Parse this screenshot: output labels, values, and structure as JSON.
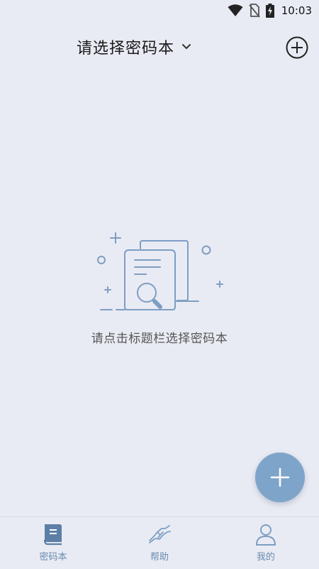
{
  "status_bar": {
    "time": "10:03",
    "icons": [
      "wifi-icon",
      "no-sim-icon",
      "battery-charging-icon"
    ]
  },
  "header": {
    "title": "请选择密码本",
    "title_icon": "chevron-down-icon",
    "action_icon": "add-circle-icon"
  },
  "empty_state": {
    "illustration": "document-search-illustration",
    "message": "请点击标题栏选择密码本"
  },
  "fab": {
    "icon": "plus-icon",
    "color": "#7FA4C9"
  },
  "bottom_nav": {
    "items": [
      {
        "label": "密码本",
        "icon": "book-icon",
        "active": true
      },
      {
        "label": "帮助",
        "icon": "handshake-icon",
        "active": false
      },
      {
        "label": "我的",
        "icon": "user-icon",
        "active": false
      }
    ]
  },
  "colors": {
    "background": "#E9EBF4",
    "accent": "#6A8BAF",
    "active_icon": "#5C7FA6"
  }
}
